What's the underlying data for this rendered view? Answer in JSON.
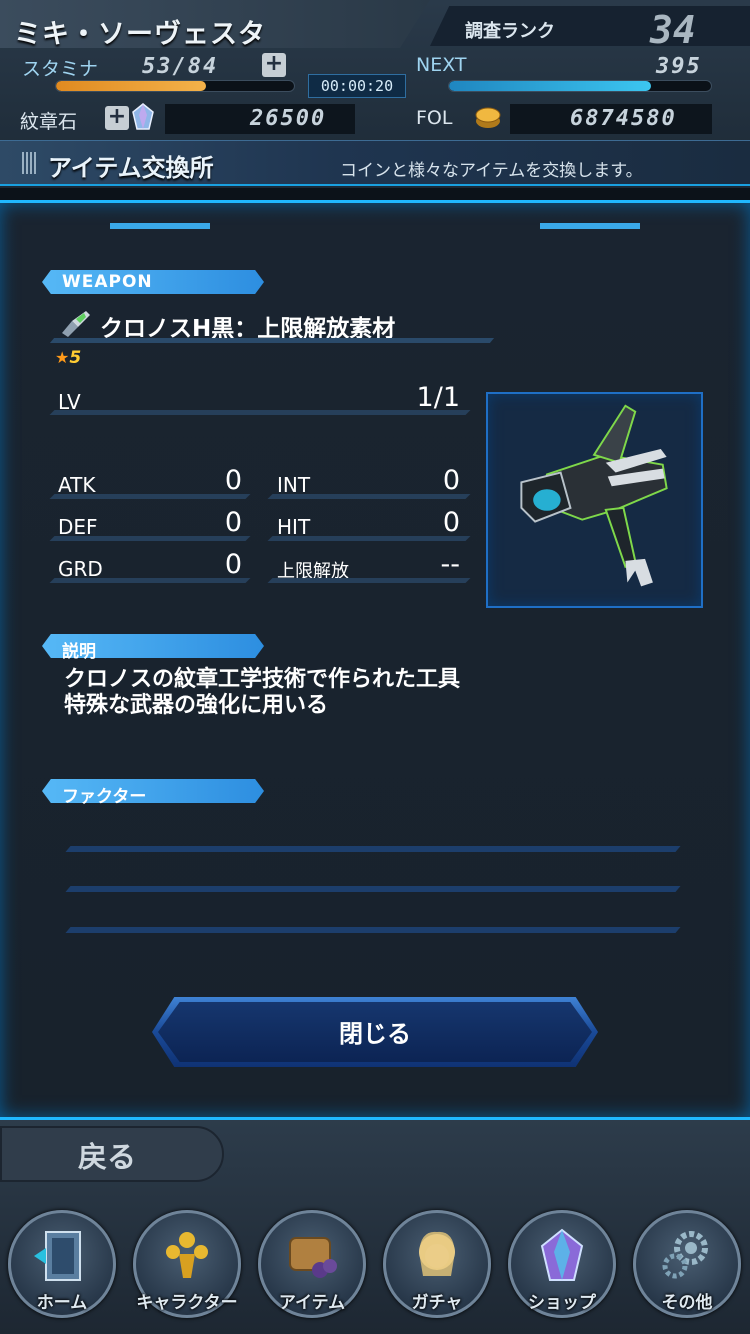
{
  "header": {
    "player_name": "ミキ・ソーヴェスタ",
    "rank_label": "調査ランク",
    "rank_value": "34",
    "stamina_label": "スタミナ",
    "stamina_value": "53/84",
    "stamina_fraction": 0.63,
    "timer": "00:00:20",
    "next_label": "NEXT",
    "next_value": "395",
    "next_fraction": 0.77,
    "crest_label": "紋章石",
    "crest_value": "26500",
    "fol_label": "FOL",
    "fol_value": "6874580"
  },
  "section": {
    "title": "アイテム交換所",
    "description": "コインと様々なアイテムを交換します。"
  },
  "item": {
    "category": "WEAPON",
    "name": "クロノスH黒：上限解放素材",
    "rarity": "5",
    "lv_label": "LV",
    "lv_value": "1/1",
    "stats": {
      "atk_label": "ATK",
      "atk_value": "0",
      "int_label": "INT",
      "int_value": "0",
      "def_label": "DEF",
      "def_value": "0",
      "hit_label": "HIT",
      "hit_value": "0",
      "grd_label": "GRD",
      "grd_value": "0",
      "limit_label": "上限解放",
      "limit_value": "--"
    },
    "description_label": "説明",
    "description_lines": [
      "クロノスの紋章工学技術で作られた工具",
      "特殊な武器の強化に用いる"
    ],
    "factor_label": "ファクター"
  },
  "close_label": "閉じる",
  "back_label": "戻る",
  "nav": [
    {
      "label": "ホーム",
      "icon": "home-door-icon"
    },
    {
      "label": "キャラクター",
      "icon": "characters-icon"
    },
    {
      "label": "アイテム",
      "icon": "item-bag-icon"
    },
    {
      "label": "ガチャ",
      "icon": "gacha-icon"
    },
    {
      "label": "ショップ",
      "icon": "shop-crystal-icon"
    },
    {
      "label": "その他",
      "icon": "gear-icon"
    }
  ],
  "colors": {
    "accent": "#20b8ff",
    "stamina": "#f0a030",
    "next": "#30b0e0",
    "rarity": "#ffcc33"
  }
}
